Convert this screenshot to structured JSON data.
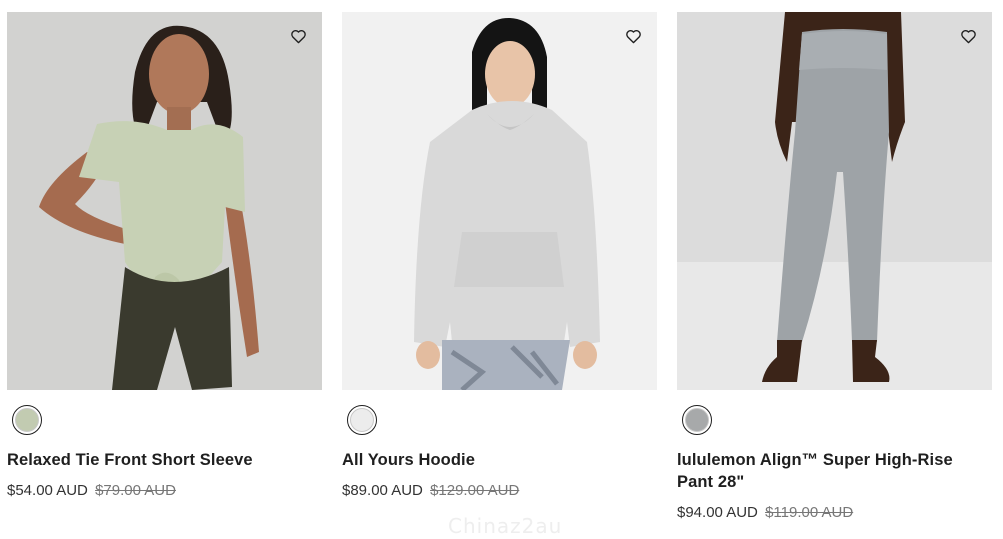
{
  "products": [
    {
      "name": "Relaxed Tie Front Short Sleeve",
      "price": "$54.00 AUD",
      "was_price": "$79.00 AUD",
      "swatch_color": "#c2cbb1",
      "image_alt": "Model wearing green relaxed tie front short sleeve top"
    },
    {
      "name": "All Yours Hoodie",
      "price": "$89.00 AUD",
      "was_price": "$129.00 AUD",
      "swatch_color": "#ececec",
      "image_alt": "Model wearing light grey hoodie"
    },
    {
      "name": "lululemon Align™ Super High-Rise Pant 28\"",
      "price": "$94.00 AUD",
      "was_price": "$119.00 AUD",
      "swatch_color": "#a7a9aa",
      "image_alt": "Model wearing grey high-rise leggings"
    }
  ],
  "watermark": "Chinaz2au",
  "icons": {
    "favorite": "heart-outline-icon"
  }
}
